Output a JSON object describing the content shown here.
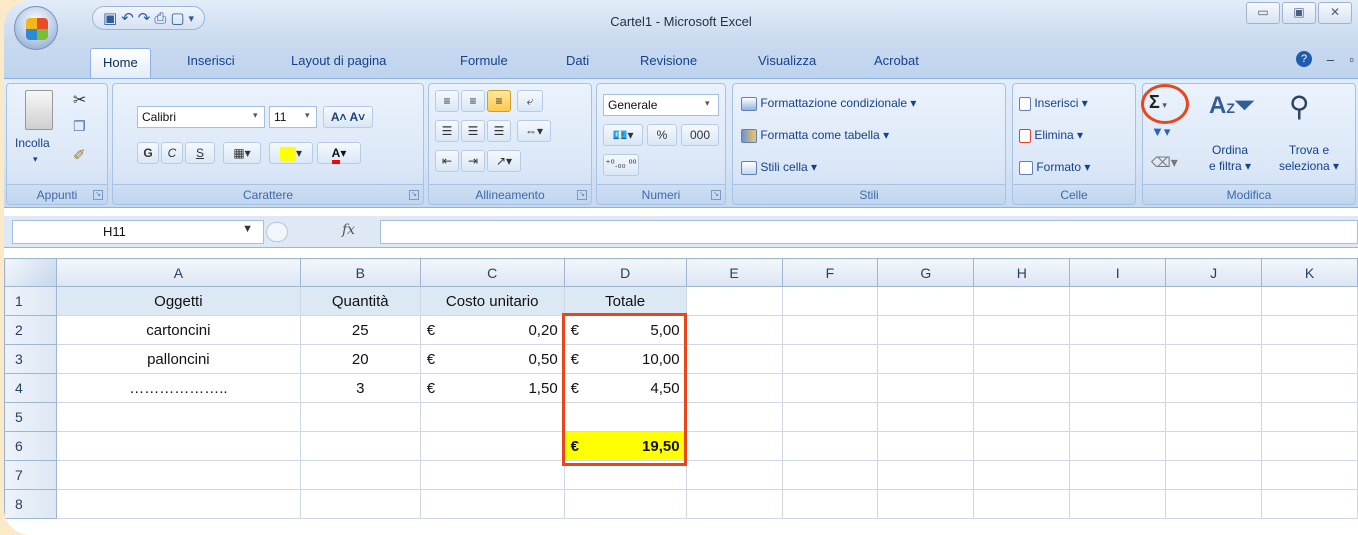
{
  "window": {
    "title": "Cartel1 - Microsoft Excel",
    "qat_icons": [
      "save-icon",
      "undo-icon",
      "redo-icon",
      "print-preview-icon",
      "new-icon"
    ],
    "controls": [
      "minimize",
      "restore",
      "close"
    ]
  },
  "tabs": [
    "Home",
    "Inserisci",
    "Layout di pagina",
    "Formule",
    "Dati",
    "Revisione",
    "Visualizza",
    "Acrobat"
  ],
  "active_tab": "Home",
  "ribbon": {
    "appunti": {
      "label": "Appunti",
      "paste": "Incolla"
    },
    "carattere": {
      "label": "Carattere",
      "font": "Calibri",
      "size": "11",
      "bold": "G",
      "italic": "C",
      "underline": "S"
    },
    "allineamento": {
      "label": "Allineamento"
    },
    "numeri": {
      "label": "Numeri",
      "format": "Generale",
      "percent": "%",
      "thousands": "000"
    },
    "stili": {
      "label": "Stili",
      "conditional": "Formattazione condizionale",
      "as_table": "Formatta come tabella",
      "cell_styles": "Stili cella"
    },
    "celle": {
      "label": "Celle",
      "insert": "Inserisci",
      "delete": "Elimina",
      "format": "Formato"
    },
    "modifica": {
      "label": "Modifica",
      "sum": "Σ",
      "sort_line1": "Ordina",
      "sort_line2": "e filtra",
      "find_line1": "Trova e",
      "find_line2": "seleziona"
    }
  },
  "formula_bar": {
    "name_box": "H11",
    "fx": "fx",
    "formula": ""
  },
  "sheet": {
    "columns": [
      "A",
      "B",
      "C",
      "D",
      "E",
      "F",
      "G",
      "H",
      "I",
      "J",
      "K"
    ],
    "headers": {
      "a": "Oggetti",
      "b": "Quantità",
      "c": "Costo unitario",
      "d": "Totale"
    },
    "rows": [
      {
        "n": "2",
        "item": "cartoncini",
        "qty": "25",
        "unit_cur": "€",
        "unit": "0,20",
        "tot_cur": "€",
        "tot": "5,00"
      },
      {
        "n": "3",
        "item": "palloncini",
        "qty": "20",
        "unit_cur": "€",
        "unit": "0,50",
        "tot_cur": "€",
        "tot": "10,00"
      },
      {
        "n": "4",
        "item": "………………..",
        "qty": "3",
        "unit_cur": "€",
        "unit": "1,50",
        "tot_cur": "€",
        "tot": "4,50"
      }
    ],
    "total": {
      "cur": "€",
      "value": "19,50"
    },
    "row_numbers": [
      "1",
      "2",
      "3",
      "4",
      "5",
      "6",
      "7",
      "8"
    ],
    "highlight_color": "#ffff00",
    "annotation_color": "#e8471e"
  }
}
